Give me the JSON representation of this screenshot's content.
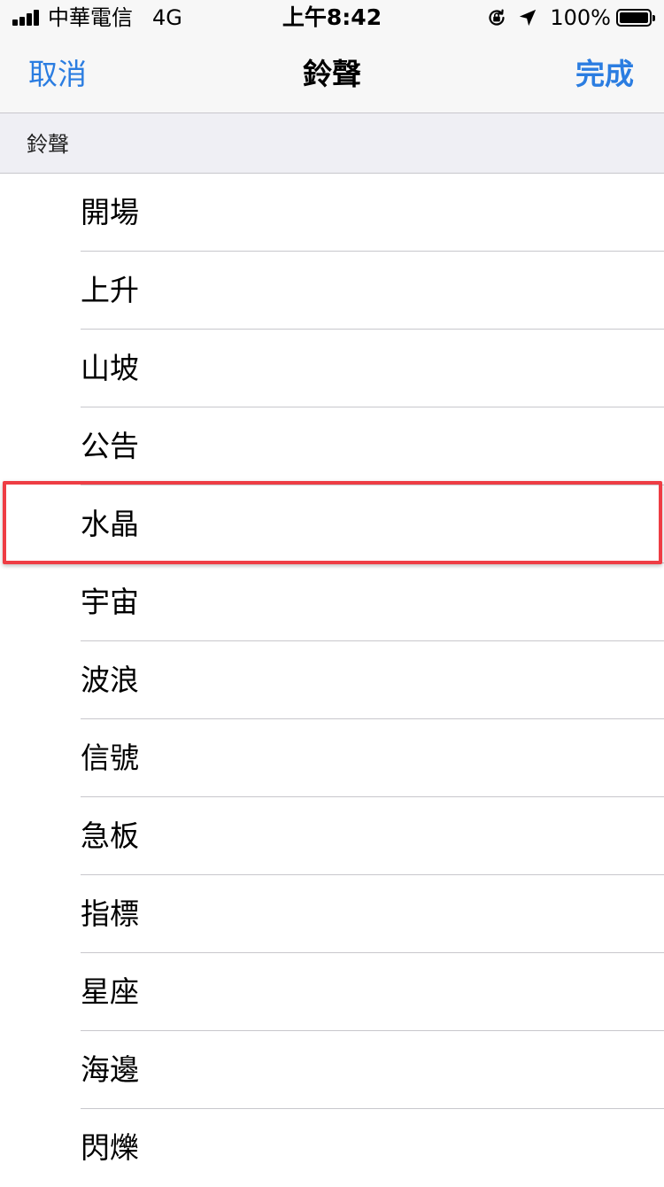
{
  "status_bar": {
    "carrier": "中華電信",
    "network": "4G",
    "time": "上午8:42",
    "battery": "100%"
  },
  "nav": {
    "cancel": "取消",
    "title": "鈴聲",
    "done": "完成"
  },
  "section": {
    "header": "鈴聲"
  },
  "ringtones": [
    "開場",
    "上升",
    "山坡",
    "公告",
    "水晶",
    "宇宙",
    "波浪",
    "信號",
    "急板",
    "指標",
    "星座",
    "海邊",
    "閃爍"
  ],
  "highlighted_item": "水晶",
  "colors": {
    "accent": "#2b7de1",
    "highlight": "#ee3d44",
    "bar_background": "#f7f7f7",
    "section_background": "#efeff4",
    "separator": "#c8c7cc"
  }
}
